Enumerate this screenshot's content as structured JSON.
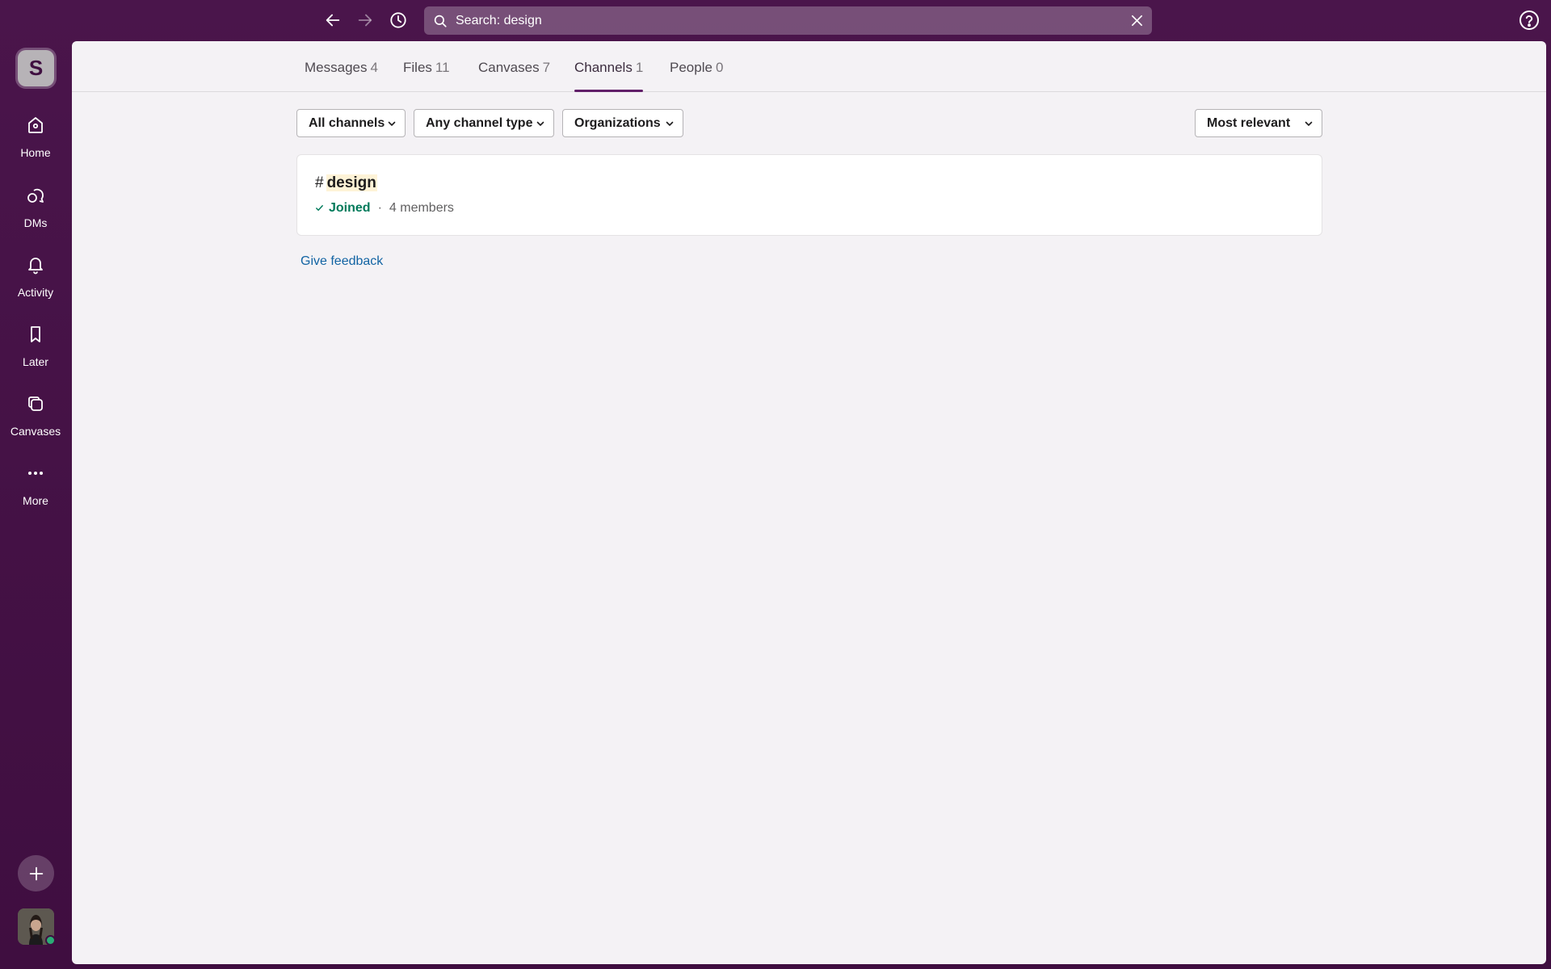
{
  "search": {
    "text": "Search: design"
  },
  "workspace": {
    "initial": "S"
  },
  "rail": {
    "items": [
      {
        "label": "Home",
        "icon": "home-icon"
      },
      {
        "label": "DMs",
        "icon": "dms-icon"
      },
      {
        "label": "Activity",
        "icon": "bell-icon"
      },
      {
        "label": "Later",
        "icon": "bookmark-icon"
      },
      {
        "label": "Canvases",
        "icon": "canvas-icon"
      },
      {
        "label": "More",
        "icon": "more-icon"
      }
    ]
  },
  "tabs": [
    {
      "label": "Messages",
      "count": "4"
    },
    {
      "label": "Files",
      "count": "11"
    },
    {
      "label": "Canvases",
      "count": "7"
    },
    {
      "label": "Channels",
      "count": "1",
      "active": true
    },
    {
      "label": "People",
      "count": "0"
    }
  ],
  "filters": {
    "all_channels": "All channels",
    "channel_type": "Any channel type",
    "organizations": "Organizations",
    "sort": "Most relevant"
  },
  "result": {
    "hash": "#",
    "name": "design",
    "status": "Joined",
    "separator": "·",
    "members": "4 members"
  },
  "feedback": "Give feedback",
  "colors": {
    "sidebar": "#3f0e40",
    "accent": "#611f69",
    "joined": "#007a5a",
    "link": "#1264a3",
    "presence": "#2bac76"
  }
}
